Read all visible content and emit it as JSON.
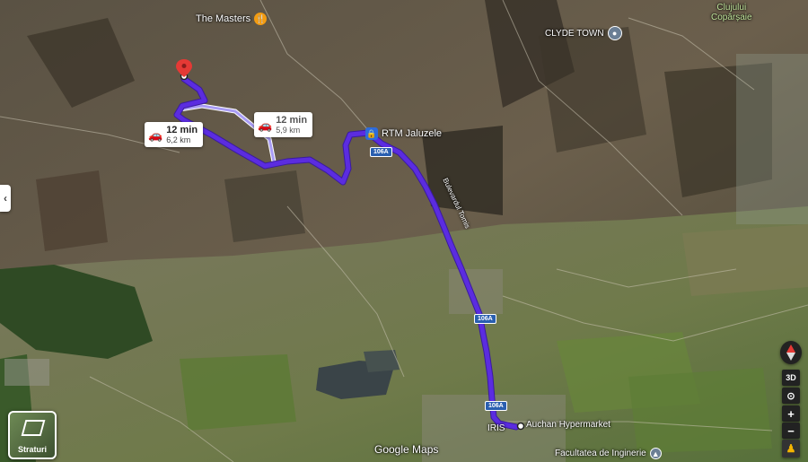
{
  "map": {
    "attribution": "Google Maps",
    "colors": {
      "route_primary": "#5b2ce0",
      "route_alt": "#a99cf5",
      "pin": "#e53935",
      "poi_food": "#f39c12",
      "poi_shop": "#2d6bdc"
    }
  },
  "places": {
    "the_masters": "The Masters",
    "clyde_town": "CLYDE TOWN",
    "clujului": "Clujului",
    "coparsaie": "Copârșaie",
    "rtm": "RTM Jaluzele",
    "auchan": "Auchan Hypermarket",
    "iris": "IRIS",
    "facultatea": "Facultatea de Inginerie",
    "road_label": "Bulevardul Tomis"
  },
  "routes": {
    "primary": {
      "time": "12 min",
      "distance": "6,2 km"
    },
    "alternate": {
      "time": "12 min",
      "distance": "5,9 km"
    }
  },
  "road_shields": [
    "106A",
    "106A",
    "106A",
    "106A"
  ],
  "controls": {
    "layers_label": "Straturi",
    "view_3d": "3D",
    "zoom_in": "+",
    "zoom_out": "−"
  }
}
